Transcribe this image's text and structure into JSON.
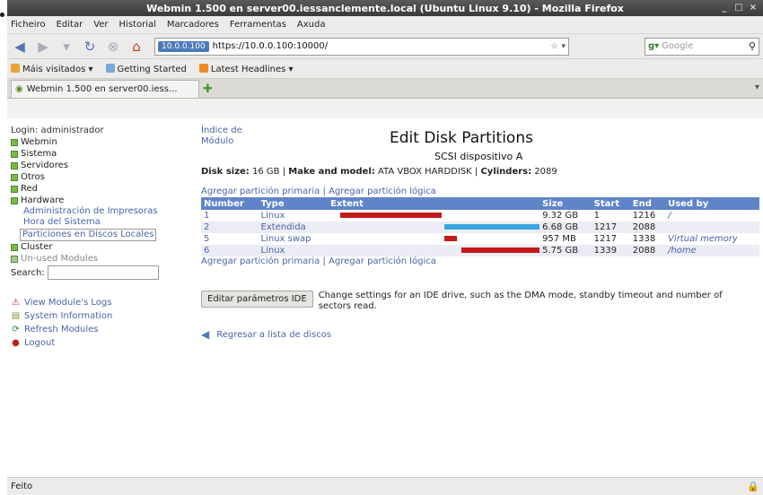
{
  "window": {
    "title": "Webmin 1.500 en server00.iessanclemente.local (Ubuntu Linux 9.10) - Mozilla Firefox",
    "controls": [
      "_",
      "□",
      "×"
    ]
  },
  "menu": [
    "Ficheiro",
    "Editar",
    "Ver",
    "Historial",
    "Marcadores",
    "Ferramentas",
    "Axuda"
  ],
  "navbar": {
    "ip_badge": "10.0.0.100",
    "url": "https://10.0.0.100:10000/",
    "search_placeholder": "Google"
  },
  "bookmarks": [
    "Máis visitados",
    "Getting Started",
    "Latest Headlines"
  ],
  "tab": {
    "label": "Webmin 1.500 en server00.iess..."
  },
  "sidebar": {
    "login": "Login: administrador",
    "categories": {
      "webmin": "Webmin",
      "sistema": "Sistema",
      "servidores": "Servidores",
      "otros": "Otros",
      "red": "Red",
      "hardware": "Hardware",
      "cluster": "Cluster",
      "unused": "Un-used Modules"
    },
    "hardware_items": {
      "impresoras": "Administración de Impresoras",
      "hora": "Hora del Sistema",
      "particiones": "Particiones en Discos Locales"
    },
    "search_label": "Search:",
    "tools": {
      "logs": "View Module's Logs",
      "sysinfo": "System Information",
      "refresh": "Refresh Modules",
      "logout": "Logout"
    }
  },
  "main": {
    "module_index": "Índice de Módulo",
    "title": "Edit Disk Partitions",
    "subtitle": "SCSI dispositivo A",
    "disk_size_label": "Disk size:",
    "disk_size": "16 GB",
    "make_label": "Make and model:",
    "make": "ATA VBOX HARDDISK",
    "cylinders_label": "Cylinders:",
    "cylinders": "2089",
    "add_primary": "Agregar partición primaria",
    "add_logical": "Agregar partición lógica",
    "separator": "|",
    "table": {
      "headers": [
        "Number",
        "Type",
        "Extent",
        "Size",
        "Start",
        "End",
        "Used by"
      ],
      "rows": [
        {
          "number": "1",
          "type": "Linux",
          "size": "9.32 GB",
          "start": "1",
          "end": "1216",
          "used": "/",
          "bar_start": 0.06,
          "bar_end": 0.54,
          "color": "#c41a1a"
        },
        {
          "number": "2",
          "type": "Extendida",
          "size": "6.68 GB",
          "start": "1217",
          "end": "2088",
          "used": "",
          "bar_start": 0.55,
          "bar_end": 1.0,
          "color": "#3aa6e0"
        },
        {
          "number": "5",
          "type": "Linux swap",
          "size": "957 MB",
          "start": "1217",
          "end": "1338",
          "used": "Virtual memory",
          "bar_start": 0.55,
          "bar_end": 0.61,
          "color": "#c41a1a"
        },
        {
          "number": "6",
          "type": "Linux",
          "size": "5.75 GB",
          "start": "1339",
          "end": "2088",
          "used": "/home",
          "bar_start": 0.63,
          "bar_end": 1.0,
          "color": "#c41a1a"
        }
      ]
    },
    "ide_button": "Editar parámetros IDE",
    "ide_desc": "Change settings for an IDE drive, such as the DMA mode, standby timeout and number of sectors read.",
    "return_link": "Regresar a lista de discos"
  },
  "status": {
    "text": "Feito"
  }
}
